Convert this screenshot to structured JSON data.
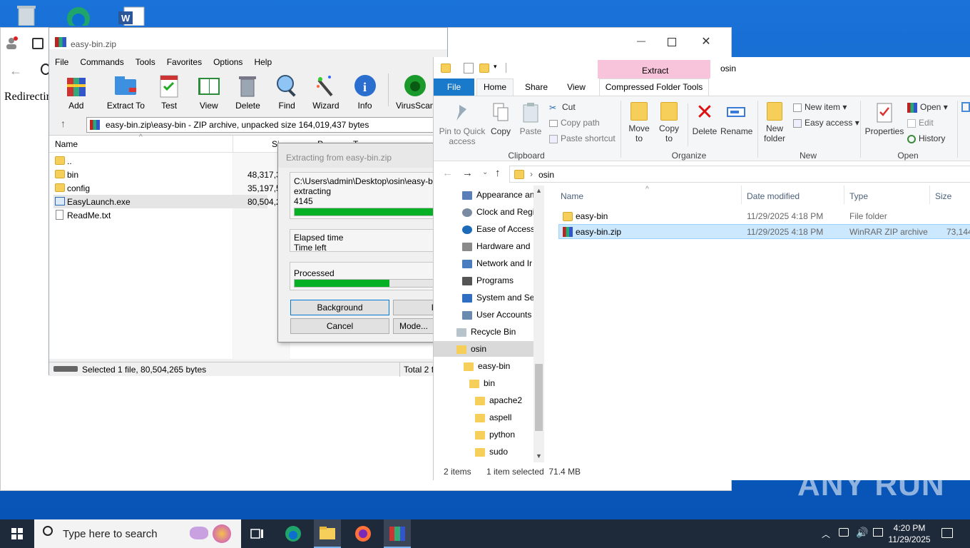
{
  "browser": {
    "page_text": "Redirectin"
  },
  "winrar": {
    "title": "easy-bin.zip",
    "menu": [
      "File",
      "Commands",
      "Tools",
      "Favorites",
      "Options",
      "Help"
    ],
    "toolbar": [
      "Add",
      "Extract To",
      "Test",
      "View",
      "Delete",
      "Find",
      "Wizard",
      "Info",
      "VirusScan",
      "C"
    ],
    "path": "easy-bin.zip\\easy-bin - ZIP archive, unpacked size 164,019,437 bytes",
    "columns": {
      "name": "Name",
      "size": "Si",
      "packed": "P",
      "type": "T"
    },
    "rows": [
      {
        "name": "..",
        "size": ""
      },
      {
        "name": "bin",
        "size": "48,317,3"
      },
      {
        "name": "config",
        "size": "35,197,5"
      },
      {
        "name": "EasyLaunch.exe",
        "size": "80,504,2"
      },
      {
        "name": "ReadMe.txt",
        "size": "2"
      }
    ],
    "status_left": "Selected 1 file, 80,504,265 bytes",
    "status_right": "Total 2 f"
  },
  "extract_dialog": {
    "title": "Extracting from easy-bin.zip",
    "path": "C:\\Users\\admin\\Desktop\\osin\\easy-bin.zi",
    "action": "extracting",
    "file_count": "4145",
    "progress_file": 0.98,
    "elapsed_label": "Elapsed time",
    "left_label": "Time left",
    "processed_label": "Processed",
    "progress_total": 0.64,
    "buttons": {
      "background": "Background",
      "pause": "I",
      "cancel": "Cancel",
      "mode": "Mode..."
    }
  },
  "explorer": {
    "title": "osin",
    "context_tab": "Extract",
    "tabs": [
      "File",
      "Home",
      "Share",
      "View",
      "Compressed Folder Tools"
    ],
    "ribbon": {
      "pin": "Pin to Quick access",
      "copy": "Copy",
      "paste": "Paste",
      "cut": "Cut",
      "copy_path": "Copy path",
      "paste_shortcut": "Paste shortcut",
      "clipboard": "Clipboard",
      "move_to": "Move to",
      "copy_to": "Copy to",
      "delete": "Delete",
      "rename": "Rename",
      "organize": "Organize",
      "new_folder": "New folder",
      "new_item": "New item",
      "easy_access": "Easy access",
      "new": "New",
      "properties": "Properties",
      "open": "Open",
      "edit": "Edit",
      "history": "History",
      "open_group": "Open"
    },
    "address": "osin",
    "nav": [
      "Appearance an",
      "Clock and Regi",
      "Ease of Access",
      "Hardware and",
      "Network and Ir",
      "Programs",
      "System and Se",
      "User Accounts",
      "Recycle Bin",
      "osin",
      "easy-bin",
      "bin",
      "apache2",
      "aspell",
      "python",
      "sudo"
    ],
    "columns": {
      "name": "Name",
      "date": "Date modified",
      "type": "Type",
      "size": "Size"
    },
    "files": [
      {
        "name": "easy-bin",
        "date": "11/29/2025 4:18 PM",
        "type": "File folder",
        "size": ""
      },
      {
        "name": "easy-bin.zip",
        "date": "11/29/2025 4:18 PM",
        "type": "WinRAR ZIP archive",
        "size": "73,144"
      }
    ],
    "status_items": "2 items",
    "status_selected": "1 item selected  71.4 MB"
  },
  "taskbar": {
    "search_placeholder": "Type here to search",
    "time": "4:20 PM",
    "date": "11/29/2025"
  },
  "watermark": "ANY RUN"
}
